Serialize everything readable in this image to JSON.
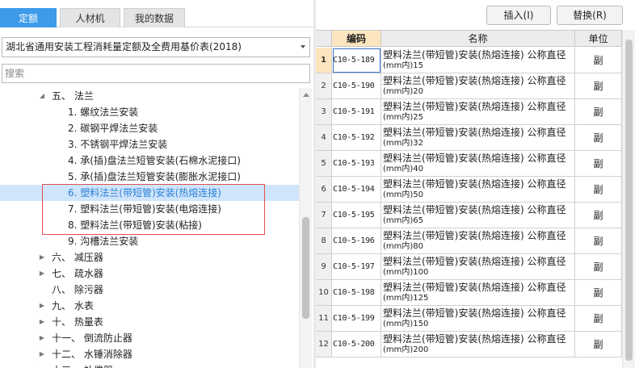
{
  "tabs": [
    {
      "label": "定额",
      "active": true
    },
    {
      "label": "人材机",
      "active": false
    },
    {
      "label": "我的数据",
      "active": false
    }
  ],
  "library_select": {
    "value": "湖北省通用安装工程消耗量定额及全费用基价表(2018)"
  },
  "search": {
    "placeholder": "搜索",
    "value": ""
  },
  "tree": [
    {
      "label": "五、 法兰",
      "expanded": true,
      "level": 1
    },
    {
      "label": "1. 螺纹法兰安装",
      "level": 2
    },
    {
      "label": "2. 碳钢平焊法兰安装",
      "level": 2
    },
    {
      "label": "3. 不锈钢平焊法兰安装",
      "level": 2
    },
    {
      "label": "4. 承(插)盘法兰短管安装(石棉水泥接口)",
      "level": 2
    },
    {
      "label": "5. 承(插)盘法兰短管安装(膨胀水泥接口)",
      "level": 2
    },
    {
      "label": "6. 塑料法兰(带短管)安装(热熔连接)",
      "level": 2,
      "selected": true
    },
    {
      "label": "7. 塑料法兰(带短管)安装(电熔连接)",
      "level": 2
    },
    {
      "label": "8. 塑料法兰(带短管)安装(粘接)",
      "level": 2
    },
    {
      "label": "9. 沟槽法兰安装",
      "level": 2
    },
    {
      "label": "六、 减压器",
      "expanded": false,
      "level": 1
    },
    {
      "label": "七、 疏水器",
      "expanded": false,
      "level": 1
    },
    {
      "label": "八、 除污器",
      "level": 1
    },
    {
      "label": "九、 水表",
      "expanded": false,
      "level": 1
    },
    {
      "label": "十、 热量表",
      "expanded": false,
      "level": 1
    },
    {
      "label": "十一、 倒流防止器",
      "expanded": false,
      "level": 1
    },
    {
      "label": "十二、 水锤消除器",
      "expanded": false,
      "level": 1
    },
    {
      "label": "十三、 补偿器",
      "expanded": false,
      "level": 1
    }
  ],
  "toolbar": {
    "insert_label": "插入(I)",
    "replace_label": "替换(R)"
  },
  "grid": {
    "headers": {
      "code": "编码",
      "name": "名称",
      "unit": "单位"
    },
    "rows": [
      {
        "num": "1",
        "code": "C10-5-189",
        "name_l1": "塑料法兰(带短管)安装(热熔连接) 公称直径",
        "name_l2": "(mm内)15",
        "unit": "副",
        "selected": true
      },
      {
        "num": "2",
        "code": "C10-5-190",
        "name_l1": "塑料法兰(带短管)安装(热熔连接) 公称直径",
        "name_l2": "(mm内)20",
        "unit": "副"
      },
      {
        "num": "3",
        "code": "C10-5-191",
        "name_l1": "塑料法兰(带短管)安装(热熔连接) 公称直径",
        "name_l2": "(mm内)25",
        "unit": "副"
      },
      {
        "num": "4",
        "code": "C10-5-192",
        "name_l1": "塑料法兰(带短管)安装(热熔连接) 公称直径",
        "name_l2": "(mm内)32",
        "unit": "副"
      },
      {
        "num": "5",
        "code": "C10-5-193",
        "name_l1": "塑料法兰(带短管)安装(热熔连接) 公称直径",
        "name_l2": "(mm内)40",
        "unit": "副"
      },
      {
        "num": "6",
        "code": "C10-5-194",
        "name_l1": "塑料法兰(带短管)安装(热熔连接) 公称直径",
        "name_l2": "(mm内)50",
        "unit": "副"
      },
      {
        "num": "7",
        "code": "C10-5-195",
        "name_l1": "塑料法兰(带短管)安装(热熔连接) 公称直径",
        "name_l2": "(mm内)65",
        "unit": "副"
      },
      {
        "num": "8",
        "code": "C10-5-196",
        "name_l1": "塑料法兰(带短管)安装(热熔连接) 公称直径",
        "name_l2": "(mm内)80",
        "unit": "副"
      },
      {
        "num": "9",
        "code": "C10-5-197",
        "name_l1": "塑料法兰(带短管)安装(热熔连接) 公称直径",
        "name_l2": "(mm内)100",
        "unit": "副"
      },
      {
        "num": "10",
        "code": "C10-5-198",
        "name_l1": "塑料法兰(带短管)安装(热熔连接) 公称直径",
        "name_l2": "(mm内)125",
        "unit": "副"
      },
      {
        "num": "11",
        "code": "C10-5-199",
        "name_l1": "塑料法兰(带短管)安装(热熔连接) 公称直径",
        "name_l2": "(mm内)150",
        "unit": "副"
      },
      {
        "num": "12",
        "code": "C10-5-200",
        "name_l1": "塑料法兰(带短管)安装(热熔连接) 公称直径",
        "name_l2": "(mm内)200",
        "unit": "副"
      }
    ]
  },
  "colors": {
    "accent": "#3d9be9",
    "selected_row": "#cfe5fb",
    "highlight_box": "#e05050",
    "code_header": "#fde6bf"
  }
}
